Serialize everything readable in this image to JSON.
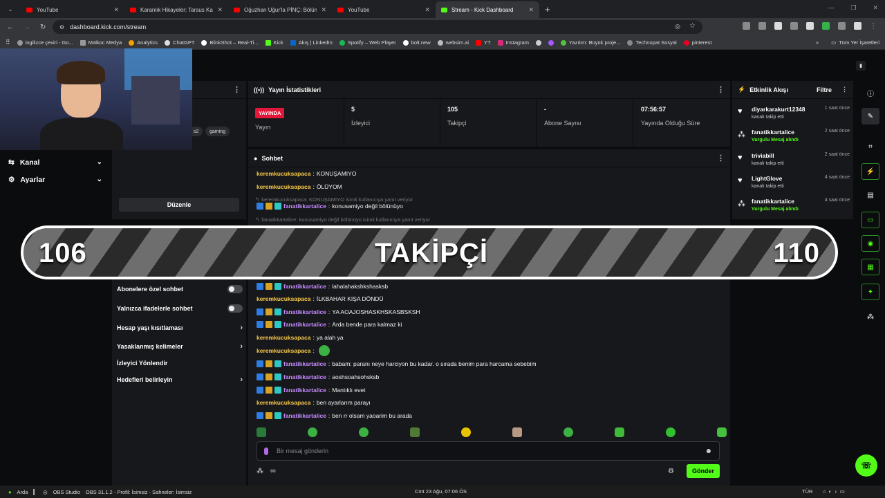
{
  "browser": {
    "tabs": [
      {
        "label": "YouTube",
        "icon": "youtube-icon"
      },
      {
        "label": "Karanlık Hikayeler: Tarsus Kazası",
        "icon": "youtube-icon"
      },
      {
        "label": "Oğuzhan Uğur'la PİNÇ: Bölüm",
        "icon": "youtube-icon"
      },
      {
        "label": "YouTube",
        "icon": "youtube-icon"
      },
      {
        "label": "Stream - Kick Dashboard",
        "icon": "kick-icon"
      }
    ],
    "new_tab": "+",
    "url": "dashboard.kick.com/stream",
    "bookmarks": [
      "ingilizce çeviri - Go...",
      "Malkoc Medya",
      "Analytics",
      "ChatGPT",
      "BlinkShot – Real-Ti...",
      "Kick",
      "Akış | LinkedIn",
      "Spotify – Web Player",
      "bolt.new",
      "websim.ai",
      "YT",
      "Instagram",
      "Yazılım: Büyük proje...",
      "Technopat Sosyal",
      "pinterest"
    ],
    "bookmarks_folder": "Tüm Yer İşaretleri"
  },
  "nav": {
    "items": [
      {
        "label": "Kanal",
        "icon": "channel-icon"
      },
      {
        "label": "Ayarlar",
        "icon": "gear-icon"
      }
    ]
  },
  "channel": {
    "tags": [
      "s2",
      "gaming"
    ],
    "edit_label": "Düzenle"
  },
  "chat_settings": {
    "toggles": [
      "Abonelere özel sohbet",
      "Yalnızca ifadelerle sohbet"
    ],
    "links": [
      "Hesap yaşı kısıtlaması",
      "Yasaklanmış kelimeler",
      "İzleyici Yönlendir",
      "Hedefleri belirleyin"
    ]
  },
  "stats": {
    "title": "Yayın İstatistikleri",
    "live_badge": "YAYINDA",
    "items": [
      {
        "value": "",
        "label": "Yayın"
      },
      {
        "value": "5",
        "label": "İzleyici"
      },
      {
        "value": "105",
        "label": "Takipçi"
      },
      {
        "value": "-",
        "label": "Abone Sayısı"
      },
      {
        "value": "07:56:57",
        "label": "Yayında Olduğu Süre"
      }
    ]
  },
  "chat": {
    "title": "Sohbet",
    "messages": [
      {
        "user": "keremkucuksapaca",
        "text": "KONUŞAMIYO",
        "style": "user1",
        "badges": false
      },
      {
        "user": "keremkucuksapaca",
        "text": "ÖLÜYOM",
        "style": "user1",
        "badges": false
      },
      {
        "reply": "keremkucuksapaca: KONUŞAMIYO isimli kullanıcıya yanıt veriyor"
      },
      {
        "user": "fanatikkartalice",
        "text": "konusamiyo değil bölünüyo",
        "style": "user2",
        "badges": true
      },
      {
        "reply": "fanatikkartalice: konusamiyo değil bölünüyo isimli kullanıcıya yanıt veriyor"
      },
      {
        "user": "fanatikkartalice",
        "text": "lahalahakshkshasksb",
        "style": "user2",
        "badges": true
      },
      {
        "user": "keremkucuksapaca",
        "text": "İLKBAHAR KIŞA DÖNDÜ",
        "style": "user1",
        "badges": false
      },
      {
        "user": "fanatikkartalice",
        "text": "YA AOAJOSHASKHSKASBSKSH",
        "style": "user2",
        "badges": true
      },
      {
        "user": "fanatikkartalice",
        "text": "Arda bende para kalmaz ki",
        "style": "user2",
        "badges": true
      },
      {
        "user": "keremkucuksapaca",
        "text": "ya alah ya",
        "style": "user1",
        "badges": false
      },
      {
        "user": "keremkucuksapaca",
        "text": "",
        "style": "user1",
        "badges": false
      },
      {
        "user": "fanatikkartalice",
        "text": "babam: paranı neye harciyon bu kadar. o sırada benim para harcama sebebim",
        "style": "user2",
        "badges": true
      },
      {
        "user": "fanatikkartalice",
        "text": "aoshsoahsohsksb",
        "style": "user2",
        "badges": true
      },
      {
        "user": "fanatikkartalice",
        "text": "Mantıklı evet",
        "style": "user2",
        "badges": true
      },
      {
        "user": "keremkucuksapaca",
        "text": "ben ayarlarım parayı",
        "style": "user1",
        "badges": false
      },
      {
        "user": "fanatikkartalice",
        "text": "ben rr olsam yaoarim bu arada",
        "style": "user2",
        "badges": true
      }
    ],
    "input_placeholder": "Bir mesaj gönderin",
    "send_label": "Gönder",
    "footer_symbol": "∞"
  },
  "activity": {
    "title": "Etkinlik Akışı",
    "filter_label": "Filtre",
    "events": [
      {
        "name": "diyarkarakurt12348",
        "sub": "kanalı takip etti",
        "time": "1 saat önce",
        "highlight": false
      },
      {
        "name": "fanatikkartalice",
        "sub": "Vurgulu Mesaj alındı",
        "time": "2 saat önce",
        "highlight": true
      },
      {
        "name": "triviabill",
        "sub": "kanalı takip etti",
        "time": "2 saat önce",
        "highlight": false
      },
      {
        "name": "LightGlove",
        "sub": "kanalı takip etti",
        "time": "4 saat önce",
        "highlight": false
      },
      {
        "name": "fanatikkartalice",
        "sub": "Vurgulu Mesaj alındı",
        "time": "4 saat önce",
        "highlight": true
      }
    ]
  },
  "goal": {
    "current": "106",
    "label": "TAKİPÇİ",
    "target": "110"
  },
  "taskbar": {
    "user": "Arda",
    "obs": "OBS Studio",
    "obs_version": "OBS 31.1.2 - Profil: İsimsiz - Sahneler: İsimsiz",
    "clock": "Cmt 23 Ağu, 07:06 ÖS",
    "lang": "TÜR"
  },
  "colors": {
    "kick_green": "#53fc18",
    "live_red": "#e2173a",
    "user_gold": "#f7c84a",
    "user_purple": "#c58cff"
  }
}
